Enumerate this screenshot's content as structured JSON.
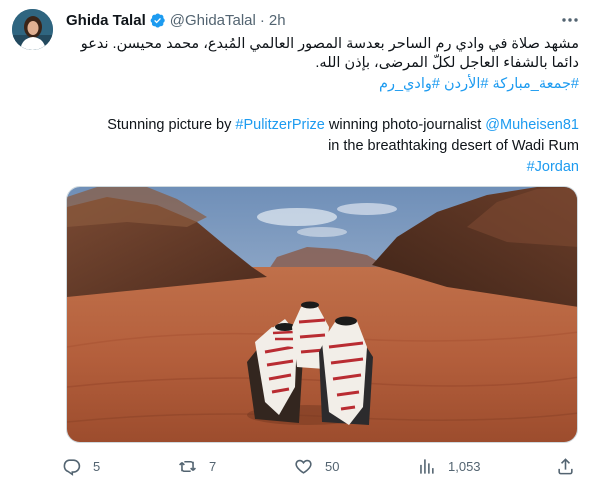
{
  "author": {
    "display_name": "Ghida Talal",
    "handle": "@GhidaTalal",
    "separator": "·",
    "time": "2h"
  },
  "tweet": {
    "arabic_text": "مشهد صلاة في وادي رم الساحر بعدسة المصور العالمي المُبدع، محمد محيسن. ندعو دائما بالشفاء العاجل لكلّ المرضى، بإذن الله.",
    "arabic_hashtags": [
      "#جمعة_مباركة",
      "#الأردن",
      "#وادي_رم"
    ],
    "english_line1_prefix": "Stunning picture by ",
    "english_line1_tag": "#PulitzerPrize",
    "english_line1_mid": " winning photo-journalist ",
    "english_line1_mention": "@Muheisen81",
    "english_line2": "in the breathtaking desert of Wadi Rum",
    "english_line3_tag": "#Jordan"
  },
  "actions": {
    "replies": "5",
    "retweets": "7",
    "likes": "50",
    "views": "1,053"
  },
  "icons": [
    "verified-badge-icon",
    "more-icon",
    "reply-icon",
    "retweet-icon",
    "like-icon",
    "views-icon",
    "share-icon"
  ],
  "colors": {
    "accent": "#1d9bf0",
    "text": "#0f1419",
    "muted": "#536471"
  }
}
